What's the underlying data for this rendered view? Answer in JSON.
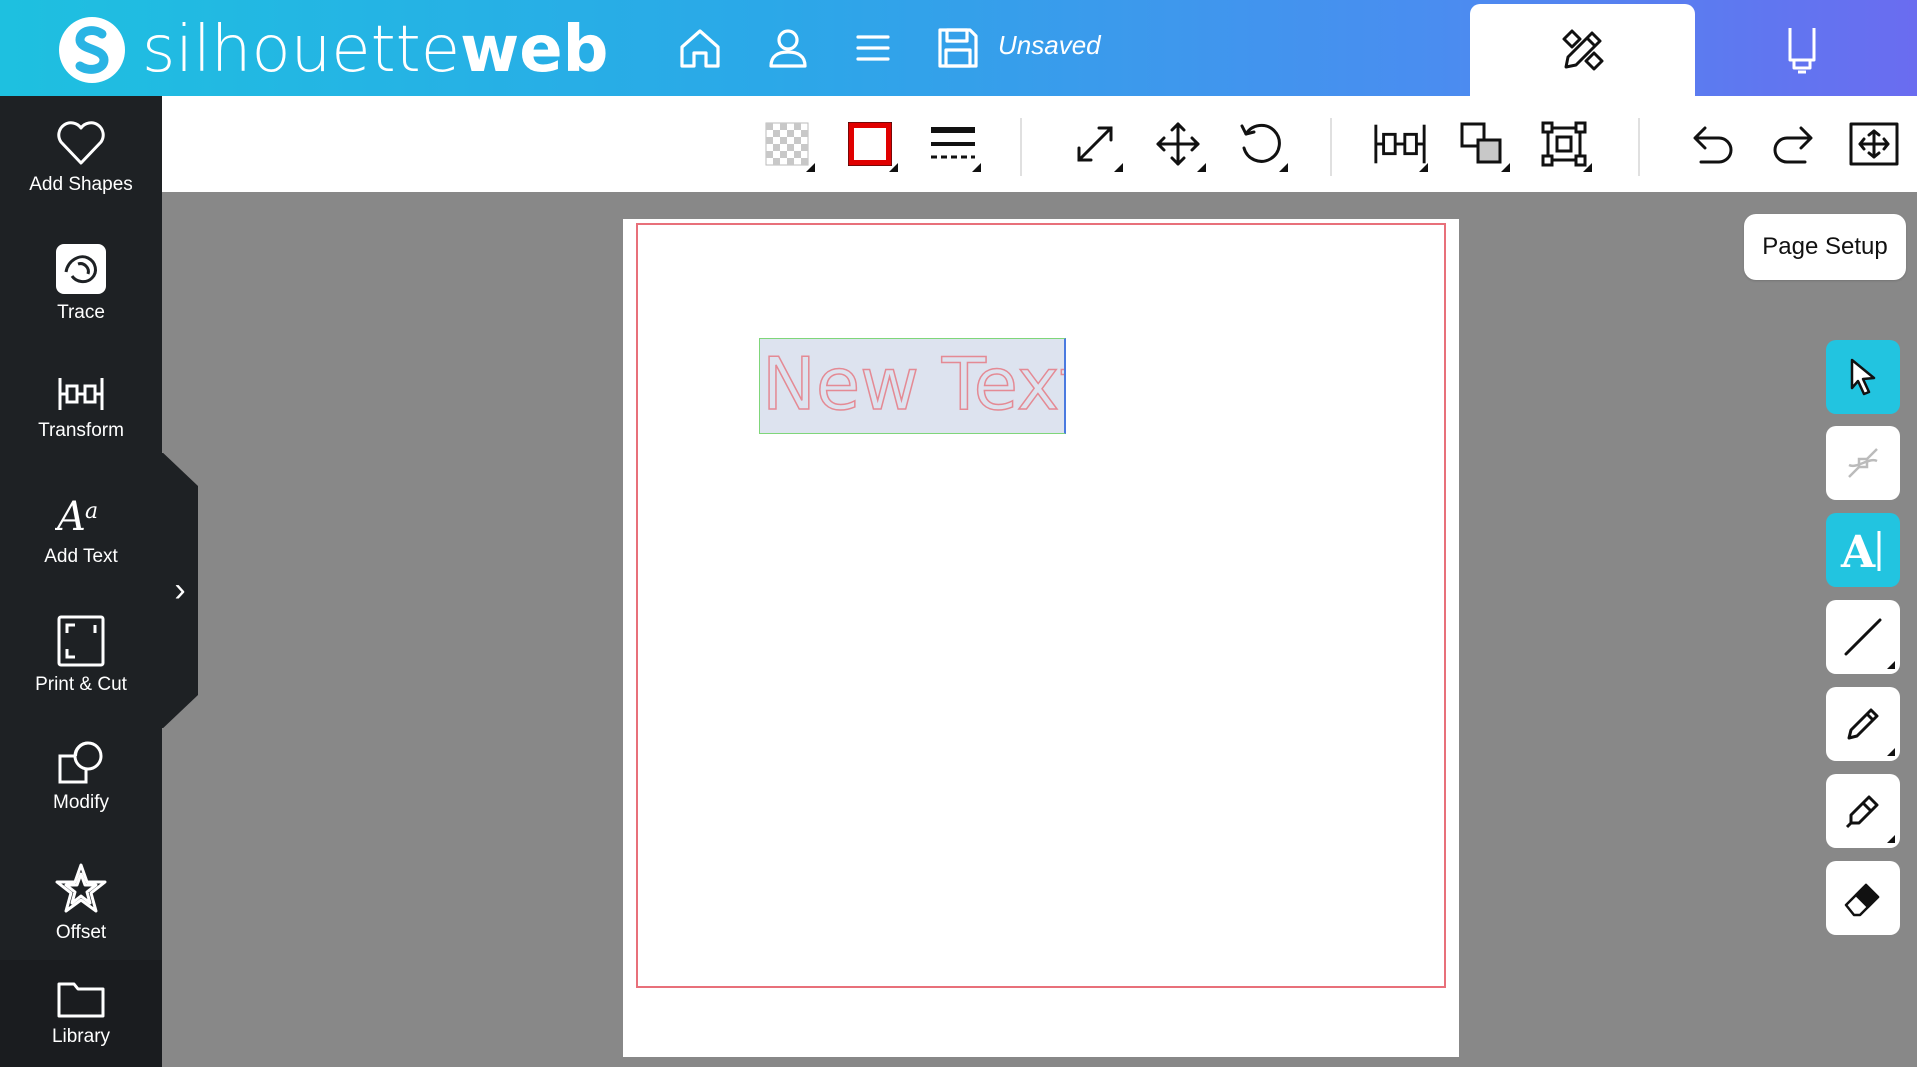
{
  "header": {
    "logo_light": "silhouette",
    "logo_bold": "web",
    "status": "Unsaved",
    "colors": {
      "gradient_start": "#1ec0e0",
      "gradient_end": "#6a6cf0"
    },
    "icons": [
      "home-icon",
      "user-icon",
      "menu-icon",
      "save-icon",
      "design-mode-icon",
      "send-mode-icon"
    ]
  },
  "toolbar": {
    "icons": [
      "fill-icon",
      "line-color-icon",
      "line-style-icon",
      "scale-icon",
      "move-icon",
      "rotate-icon",
      "align-icon",
      "arrange-icon",
      "group-icon",
      "undo-icon",
      "redo-icon",
      "zoom-fit-icon"
    ],
    "line_color": "#e00000"
  },
  "sidebar": {
    "items": [
      {
        "label": "Add Shapes",
        "icon": "heart-icon"
      },
      {
        "label": "Trace",
        "icon": "trace-icon"
      },
      {
        "label": "Transform",
        "icon": "transform-icon"
      },
      {
        "label": "Add Text",
        "icon": "text-icon"
      },
      {
        "label": "Print & Cut",
        "icon": "print-cut-icon"
      },
      {
        "label": "Modify",
        "icon": "modify-icon"
      },
      {
        "label": "Offset",
        "icon": "star-icon"
      },
      {
        "label": "Library",
        "icon": "folder-icon"
      }
    ],
    "expand_glyph": "›"
  },
  "canvas": {
    "text_object": "New Text",
    "cut_border_color": "#e8707a"
  },
  "right_panel": {
    "page_setup_label": "Page Setup",
    "tools": [
      {
        "name": "select",
        "icon": "pointer-icon",
        "active": true
      },
      {
        "name": "point-edit",
        "icon": "point-edit-icon",
        "active": false
      },
      {
        "name": "text",
        "icon": "text-cursor-icon",
        "active": true
      },
      {
        "name": "line",
        "icon": "line-icon",
        "active": false
      },
      {
        "name": "pen",
        "icon": "pen-icon",
        "active": false
      },
      {
        "name": "pencil",
        "icon": "pencil-icon",
        "active": false
      },
      {
        "name": "eraser",
        "icon": "eraser-icon",
        "active": false
      }
    ],
    "accent_color": "#22c4e0"
  }
}
